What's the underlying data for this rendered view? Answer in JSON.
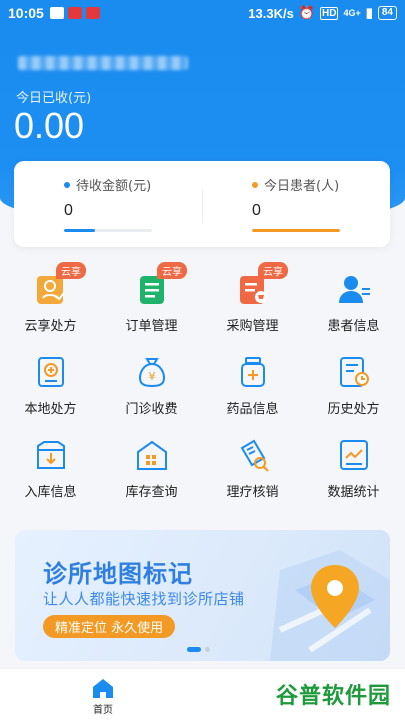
{
  "status_bar": {
    "time": "10:05",
    "speed": "13.3K/s",
    "network": "4G+",
    "battery": "84"
  },
  "header": {
    "today_income_label": "今日已收(元)",
    "today_income_value": "0.00"
  },
  "stats": [
    {
      "label": "待收金额(元)",
      "value": "0",
      "color": "#1a8cf0",
      "progress": 0.35
    },
    {
      "label": "今日患者(人)",
      "value": "0",
      "color": "#f39a24",
      "progress": 1.0
    }
  ],
  "grid": [
    {
      "label": "云享处方",
      "icon": "cloud-prescription-icon",
      "badge": "云享",
      "color": "#f3a93a"
    },
    {
      "label": "订单管理",
      "icon": "order-icon",
      "badge": "云享",
      "color": "#1fb26b"
    },
    {
      "label": "采购管理",
      "icon": "purchase-icon",
      "badge": "云享",
      "color": "#ef6a44"
    },
    {
      "label": "患者信息",
      "icon": "patient-icon",
      "badge": "",
      "color": "#1a8cf0"
    },
    {
      "label": "本地处方",
      "icon": "local-prescription-icon",
      "badge": "",
      "color": "#1a8cf0"
    },
    {
      "label": "门诊收费",
      "icon": "money-bag-icon",
      "badge": "",
      "color": "#1a8cf0"
    },
    {
      "label": "药品信息",
      "icon": "medicine-icon",
      "badge": "",
      "color": "#1a8cf0"
    },
    {
      "label": "历史处方",
      "icon": "history-icon",
      "badge": "",
      "color": "#1a8cf0"
    },
    {
      "label": "入库信息",
      "icon": "inbound-icon",
      "badge": "",
      "color": "#1a8cf0"
    },
    {
      "label": "库存查询",
      "icon": "warehouse-icon",
      "badge": "",
      "color": "#1a8cf0"
    },
    {
      "label": "理疗核销",
      "icon": "ticket-check-icon",
      "badge": "",
      "color": "#1a8cf0"
    },
    {
      "label": "数据统计",
      "icon": "stats-icon",
      "badge": "",
      "color": "#1a8cf0"
    }
  ],
  "banner": {
    "title": "诊所地图标记",
    "subtitle": "让人人都能快速找到诊所店铺",
    "pill": "精准定位 永久使用"
  },
  "tabbar": {
    "home_label": "首页"
  },
  "watermark": "谷普软件园",
  "colors": {
    "primary": "#1a8cf0",
    "orange": "#f39a24",
    "badge": "#ef6a44"
  }
}
